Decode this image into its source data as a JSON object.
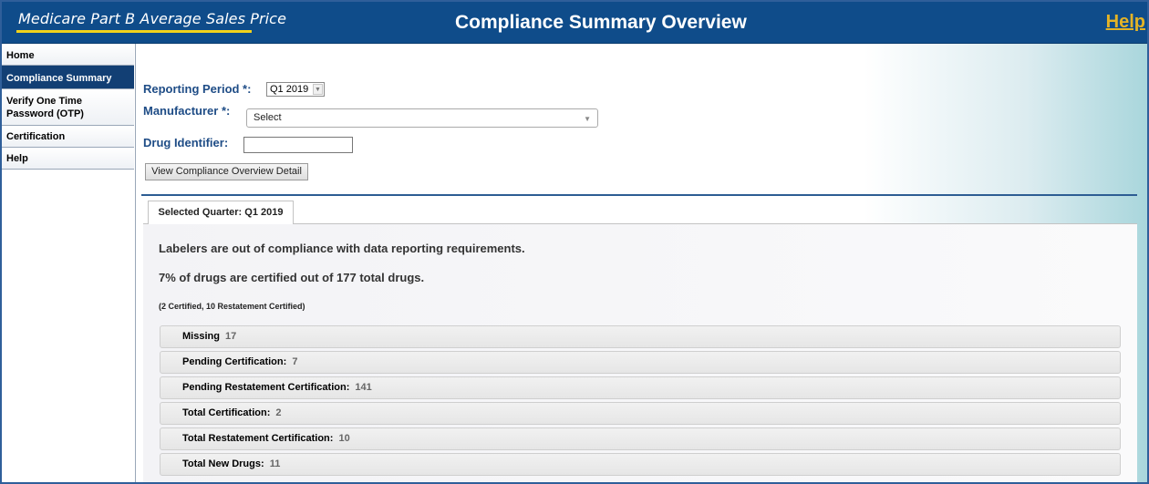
{
  "header": {
    "app_title": "Medicare Part B Average Sales Price",
    "page_heading": "Compliance Summary Overview",
    "help_link": "Help"
  },
  "sidebar": {
    "items": [
      {
        "label": "Home",
        "active": false
      },
      {
        "label": "Compliance Summary",
        "active": true
      },
      {
        "label": "Verify One Time Password (OTP)",
        "active": false
      },
      {
        "label": "Certification",
        "active": false
      },
      {
        "label": "Help",
        "active": false
      }
    ]
  },
  "form": {
    "reporting_period_label": "Reporting Period *:",
    "reporting_period_value": "Q1 2019",
    "manufacturer_label": "Manufacturer *:",
    "manufacturer_value": "Select",
    "drug_identifier_label": "Drug Identifier:",
    "drug_identifier_value": "",
    "view_button": "View Compliance Overview Detail"
  },
  "summary": {
    "tab_label": "Selected Quarter: Q1 2019",
    "message1": "Labelers are out of compliance with data reporting requirements.",
    "message2": "7% of drugs are certified out of 177 total drugs.",
    "message3": "(2 Certified, 10 Restatement Certified)",
    "sections": [
      {
        "label": "Missing",
        "count": "17"
      },
      {
        "label": "Pending Certification:",
        "count": "7"
      },
      {
        "label": "Pending Restatement Certification:",
        "count": "141"
      },
      {
        "label": "Total Certification:",
        "count": "2"
      },
      {
        "label": "Total Restatement Certification:",
        "count": "10"
      },
      {
        "label": "Total New Drugs:",
        "count": "11"
      }
    ]
  },
  "colors": {
    "header_bg": "#0f4c8a",
    "help_link": "#e4b326",
    "title_underline": "#f2d21b",
    "active_nav": "#123f74",
    "form_label": "#1e4c86"
  }
}
